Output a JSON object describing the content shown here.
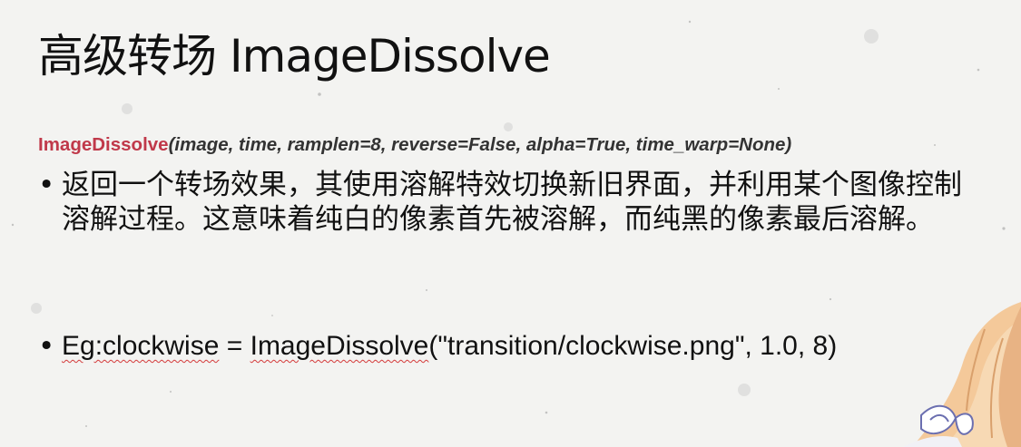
{
  "slide": {
    "title": "高级转场 ImageDissolve",
    "signature": {
      "function_name": "ImageDissolve",
      "args": "(image, time, ramplen=8, reverse=False, alpha=True, time_warp=None)"
    },
    "bullets": [
      {
        "marker": "•",
        "text": "返回一个转场效果，其使用溶解特效切换新旧界面，并利用某个图像控制溶解过程。这意味着纯白的像素首先被溶解，而纯黑的像素最后溶解。"
      },
      {
        "marker": "•",
        "parts": {
          "eg": "Eg:clockwise",
          "eq": " = ",
          "func": "ImageDissolve",
          "rest": "(\"transition/clockwise.png\", 1.0, 8)"
        }
      }
    ]
  },
  "colors": {
    "background": "#f3f3f1",
    "function_name": "#c0394a",
    "signature_args": "#333333",
    "spellcheck_underline": "#d43a3a"
  }
}
